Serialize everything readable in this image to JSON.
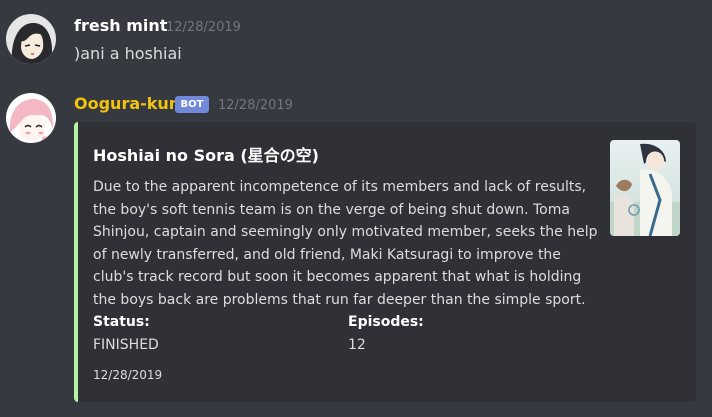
{
  "messages": [
    {
      "author": "fresh mint",
      "timestamp": "12/28/2019",
      "content": ")ani a hoshiai",
      "author_color": "#ffffff"
    },
    {
      "author": "Oogura-kun",
      "bot_tag": "BOT",
      "timestamp": "12/28/2019",
      "author_color": "#f1c40f",
      "embed": {
        "accent_color": "#b8f2a6",
        "title": "Hoshiai no Sora (星合の空)",
        "description_lines": [
          "Due to the apparent incompetence of its members and lack of results,",
          "the boy's soft tennis team is on the verge of being shut down. Toma",
          "Shinjou, captain and seemingly only motivated member, seeks the help",
          "of newly transferred, and old friend, Maki Katsuragi to improve the",
          "club's track record but soon it becomes apparent that what is holding",
          "the boys back are problems that run far deeper than the simple sport."
        ],
        "fields": [
          {
            "name": "Status:",
            "value": "FINISHED"
          },
          {
            "name": "Episodes:",
            "value": "12"
          }
        ],
        "footer": "12/28/2019"
      }
    }
  ]
}
